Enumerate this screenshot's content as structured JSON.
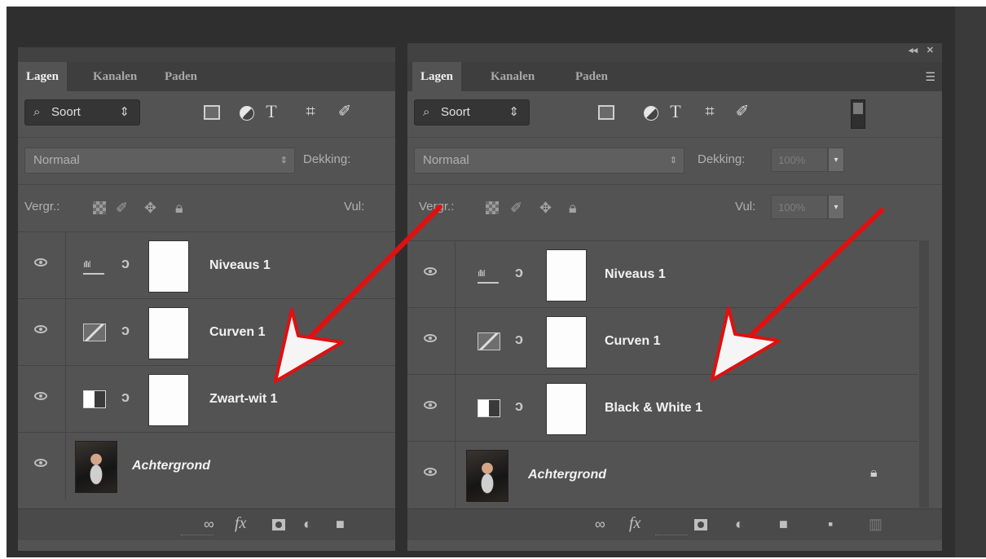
{
  "left_panel": {
    "tabs": [
      {
        "label": "Lagen",
        "active": true
      },
      {
        "label": "Kanalen",
        "active": false
      },
      {
        "label": "Paden",
        "active": false
      }
    ],
    "filter": {
      "label": "Soort",
      "icon": "search-icon"
    },
    "blend_mode": "Normaal",
    "opacity_label": "Dekking:",
    "lock_label": "Vergr.:",
    "fill_label": "Vul:",
    "layers": [
      {
        "name": "Niveaus 1",
        "type": "levels"
      },
      {
        "name": "Curven 1",
        "type": "curves"
      },
      {
        "name": "Zwart-wit 1",
        "type": "black-white"
      },
      {
        "name": "Achtergrond",
        "type": "background"
      }
    ],
    "bottom_icons": [
      "link-icon",
      "fx-icon",
      "mask-icon",
      "adjustment-icon",
      "folder-icon"
    ]
  },
  "right_panel": {
    "controls": {
      "collapse": "◂◂",
      "close": "✕"
    },
    "tabs": [
      {
        "label": "Lagen",
        "active": true
      },
      {
        "label": "Kanalen",
        "active": false
      },
      {
        "label": "Paden",
        "active": false
      }
    ],
    "filter": {
      "label": "Soort",
      "icon": "search-icon"
    },
    "blend_mode": "Normaal",
    "opacity_label": "Dekking:",
    "opacity_value": "100%",
    "lock_label": "Vergr.:",
    "fill_label": "Vul:",
    "fill_value": "100%",
    "layers": [
      {
        "name": "Niveaus 1",
        "type": "levels"
      },
      {
        "name": "Curven 1",
        "type": "curves"
      },
      {
        "name": "Black & White 1",
        "type": "black-white"
      },
      {
        "name": "Achtergrond",
        "type": "background",
        "locked": true
      }
    ],
    "bottom_icons": [
      "link-icon",
      "fx-icon",
      "mask-icon",
      "adjustment-icon",
      "folder-icon",
      "new-layer-icon",
      "trash-icon"
    ]
  },
  "glyphs": {
    "search": "⌕",
    "updown": "⇕",
    "text_tool": "T",
    "crop": "⌗",
    "brush": "✐",
    "move": "✥",
    "lock": "🔒︎",
    "link": "∞",
    "chain": "ↄ",
    "fx": "fx",
    "menu": "☰"
  },
  "colors": {
    "panel_bg": "#535353",
    "tabbar_bg": "#3e3e3e",
    "annotation_arrow": "#e01010"
  }
}
